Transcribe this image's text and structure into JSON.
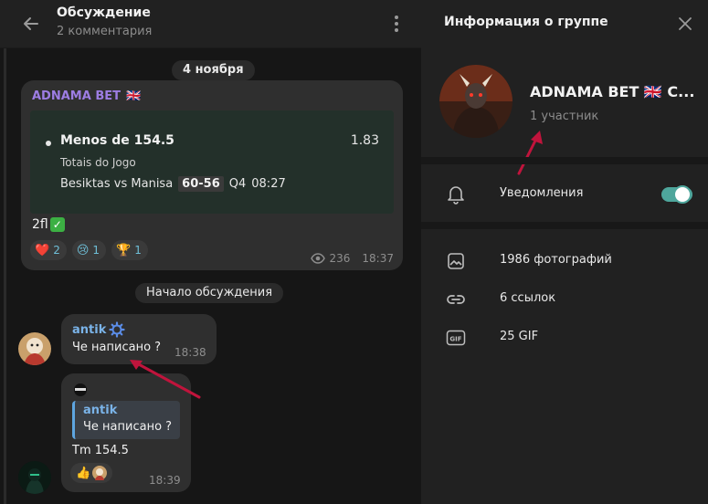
{
  "header": {
    "title": "Обсуждение",
    "subtitle": "2 комментария"
  },
  "chat": {
    "date_pill": "4 ноября",
    "discussion_start_pill": "Начало обсуждения",
    "channel_post": {
      "channel_name": "ADNAMA BET",
      "channel_flag": "🇬🇧",
      "bet": {
        "selection": "Menos de 154.5",
        "odds": "1.83",
        "market": "Totais do Jogo",
        "match": "Besiktas vs Manisa",
        "score": "60-56",
        "period": "Q4",
        "clock": "08:27"
      },
      "text": "2fl",
      "text_emoji": "✅",
      "reactions": [
        {
          "emoji": "❤️",
          "count": "2"
        },
        {
          "emoji": "😢",
          "count": "1"
        },
        {
          "emoji": "🏆",
          "count": "1"
        }
      ],
      "views": "236",
      "time": "18:37"
    },
    "message1": {
      "author": "antik",
      "text": "Че написано ?",
      "time": "18:38"
    },
    "message2": {
      "reply_author": "antik",
      "reply_text": "Че написано ?",
      "text": "Tm 154.5",
      "reaction_emoji": "👍",
      "time": "18:39"
    }
  },
  "info_panel": {
    "title": "Информация о группе",
    "group_name": "ADNAMA BET 🇬🇧 C...",
    "members": "1 участник",
    "notifications_label": "Уведомления",
    "notifications_on": true,
    "media": [
      {
        "icon": "photo-icon",
        "label": "1986 фотографий"
      },
      {
        "icon": "link-icon",
        "label": "6 ссылок"
      },
      {
        "icon": "gif-icon",
        "label": "25 GIF"
      }
    ]
  },
  "colors": {
    "accent_toggle": "#4ea69c",
    "channel_name": "#9d7de3",
    "author_name": "#7ab3e8",
    "annotation_arrow": "#c0143c"
  }
}
